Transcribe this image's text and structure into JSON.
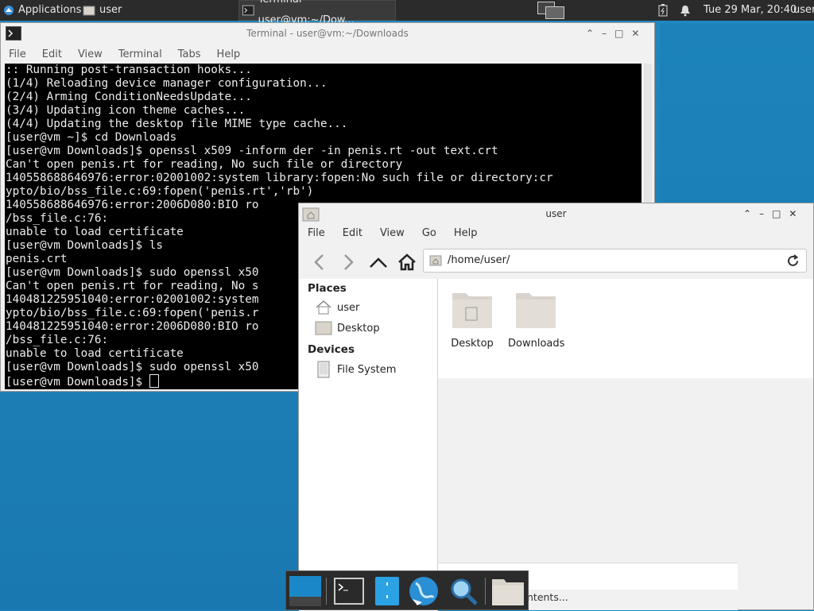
{
  "top_panel": {
    "applications_label": "Applications",
    "home_task_label": "user",
    "terminal_task_label": "Terminal - user@vm:~/Dow...",
    "clock": "Tue 29 Mar, 20:40",
    "user": "user"
  },
  "terminal": {
    "title": "Terminal - user@vm:~/Downloads",
    "menu": [
      "File",
      "Edit",
      "View",
      "Terminal",
      "Tabs",
      "Help"
    ],
    "lines": [
      ":: Running post-transaction hooks...",
      "(1/4) Reloading device manager configuration...",
      "(2/4) Arming ConditionNeedsUpdate...",
      "(3/4) Updating icon theme caches...",
      "(4/4) Updating the desktop file MIME type cache...",
      "[user@vm ~]$ cd Downloads",
      "[user@vm Downloads]$ openssl x509 -inform der -in penis.rt -out text.crt",
      "Can't open penis.rt for reading, No such file or directory",
      "140558688646976:error:02001002:system library:fopen:No such file or directory:cr",
      "ypto/bio/bss_file.c:69:fopen('penis.rt','rb')",
      "140558688646976:error:2006D080:BIO ro",
      "/bss_file.c:76:",
      "unable to load certificate",
      "[user@vm Downloads]$ ls",
      "penis.crt",
      "[user@vm Downloads]$ sudo openssl x50",
      "Can't open penis.rt for reading, No s",
      "140481225951040:error:02001002:system",
      "ypto/bio/bss_file.c:69:fopen('penis.r",
      "140481225951040:error:2006D080:BIO ro",
      "/bss_file.c:76:",
      "unable to load certificate",
      "[user@vm Downloads]$ sudo openssl x50",
      "[user@vm Downloads]$ "
    ]
  },
  "file_manager": {
    "title": "user",
    "menu": [
      "File",
      "Edit",
      "View",
      "Go",
      "Help"
    ],
    "location": "/home/user/",
    "places_heading": "Places",
    "places": [
      "user",
      "Desktop"
    ],
    "devices_heading": "Devices",
    "devices": [
      "File System"
    ],
    "folders": [
      "Desktop",
      "Downloads"
    ],
    "status_fragment": "ntents..."
  }
}
